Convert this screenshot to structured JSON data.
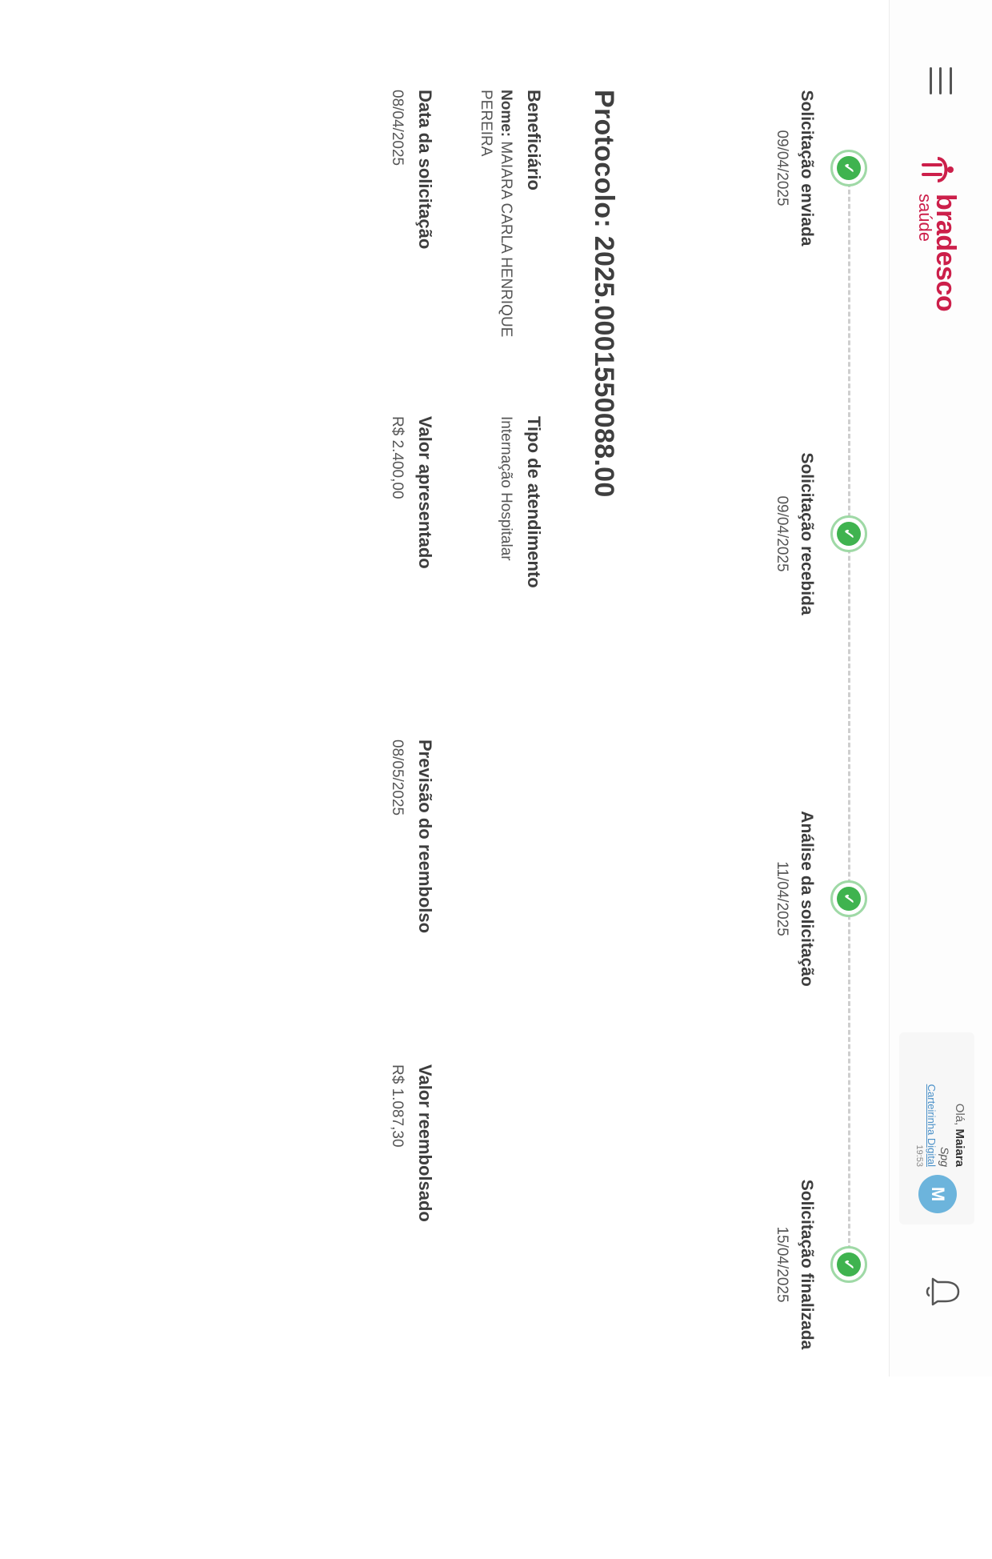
{
  "header": {
    "brand": "bradesco",
    "brand_sub": "saúde",
    "user": {
      "greeting_prefix": "Olá,",
      "name": "Maiara",
      "subtitle": "Spg",
      "card_link": "Carteirinha Digital",
      "time": "19:53",
      "avatar_initial": "M"
    }
  },
  "timeline": {
    "steps": [
      {
        "title": "Solicitação enviada",
        "date": "09/04/2025",
        "status": "done"
      },
      {
        "title": "Solicitação recebida",
        "date": "09/04/2025",
        "status": "done"
      },
      {
        "title": "Análise da solicitação",
        "date": "11/04/2025",
        "status": "done"
      },
      {
        "title": "Solicitação finalizada",
        "date": "15/04/2025",
        "status": "done"
      }
    ]
  },
  "protocol": {
    "label": "Protocolo: 2025.0001550088.00"
  },
  "details": {
    "beneficiario": {
      "label": "Beneficiário",
      "name_prefix": "Nome:",
      "name_value": "MAIARA CARLA HENRIQUE PEREIRA"
    },
    "tipo_atendimento": {
      "label": "Tipo de atendimento",
      "value": "Internação Hospitalar"
    },
    "data_solicitacao": {
      "label": "Data da solicitação",
      "value": "08/04/2025"
    },
    "valor_apresentado": {
      "label": "Valor apresentado",
      "value": "R$ 2.400,00"
    },
    "previsao_reembolso": {
      "label": "Previsão do reembolso",
      "value": "08/05/2025"
    },
    "valor_reembolsado": {
      "label": "Valor reembolsado",
      "value": "R$ 1.087,30"
    }
  },
  "colors": {
    "brand": "#cc1f4a",
    "success": "#3fb34f",
    "avatar": "#6cb4dc",
    "link": "#4a90c8"
  },
  "icons": {
    "menu": "hamburger-menu-icon",
    "logo": "bradesco-logo-mark",
    "notification": "bell-icon",
    "step_status": "check-icon"
  }
}
